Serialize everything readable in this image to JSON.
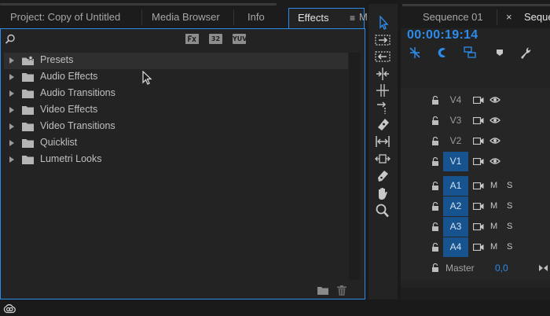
{
  "project_panel": {
    "tabs": [
      {
        "label": "Project: Copy of Untitled"
      },
      {
        "label": "Media Browser"
      },
      {
        "label": "Info"
      },
      {
        "label": "Effects"
      },
      {
        "label": "M"
      }
    ],
    "menu_glyph": "≡"
  },
  "effects": {
    "filter_buttons": [
      "fx-accelerated-icon",
      "32",
      "YUV"
    ],
    "items": [
      {
        "label": "Presets",
        "icon": "preset-folder-icon"
      },
      {
        "label": "Audio Effects",
        "icon": "folder-icon"
      },
      {
        "label": "Audio Transitions",
        "icon": "folder-icon"
      },
      {
        "label": "Video Effects",
        "icon": "folder-icon"
      },
      {
        "label": "Video Transitions",
        "icon": "folder-icon"
      },
      {
        "label": "Quicklist",
        "icon": "folder-icon"
      },
      {
        "label": "Lumetri Looks",
        "icon": "folder-icon"
      }
    ]
  },
  "tools": [
    "selection-tool-icon",
    "track-select-forward-icon",
    "track-select-backward-icon",
    "ripple-edit-icon",
    "rolling-edit-icon",
    "rate-stretch-icon",
    "razor-icon",
    "slip-icon",
    "slide-icon",
    "pen-icon",
    "hand-icon",
    "zoom-icon"
  ],
  "timeline": {
    "tabs": [
      {
        "label": "Sequence 01"
      },
      {
        "label": "Seque"
      }
    ],
    "close_glyph": "×",
    "timecode": "00:00:19:14",
    "video_tracks": [
      "V4",
      "V3",
      "V2",
      "V1"
    ],
    "audio_tracks": [
      "A1",
      "A2",
      "A3",
      "A4"
    ],
    "mute_label": "M",
    "solo_label": "S",
    "master_label": "Master",
    "master_value": "0,0"
  },
  "colors": {
    "accent": "#2d8ceb",
    "track_selected": "#17538e"
  }
}
